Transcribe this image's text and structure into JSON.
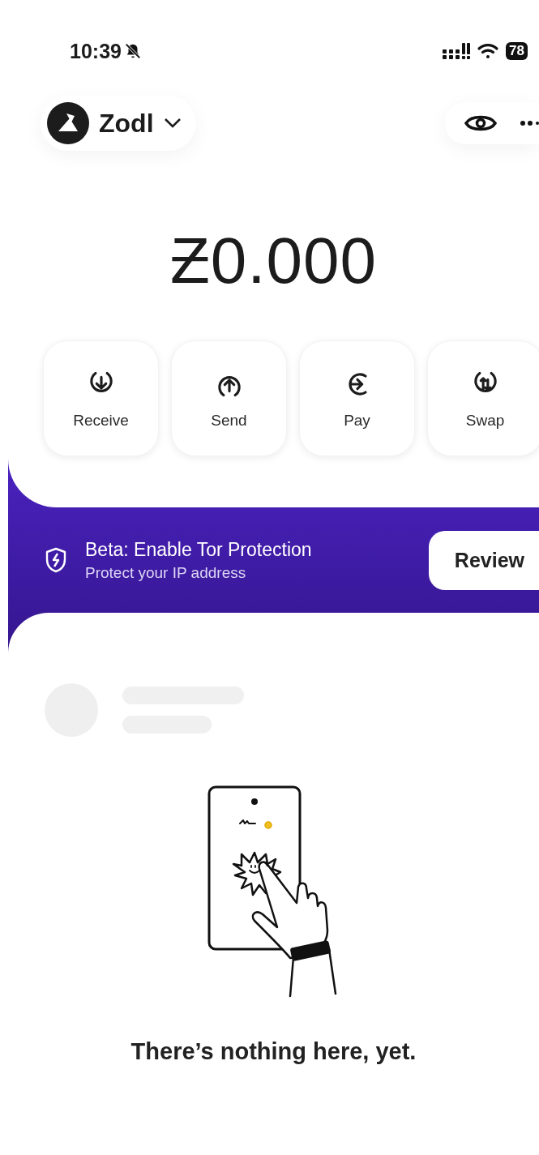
{
  "status_bar": {
    "time": "10:39",
    "battery": "78"
  },
  "header": {
    "wallet_name": "Zodl"
  },
  "balance": "Ƶ0.000",
  "actions": [
    {
      "label": "Receive",
      "kind": "receive"
    },
    {
      "label": "Send",
      "kind": "send"
    },
    {
      "label": "Pay",
      "kind": "pay"
    },
    {
      "label": "Swap",
      "kind": "swap"
    }
  ],
  "banner": {
    "title": "Beta: Enable Tor Protection",
    "subtitle": "Protect your IP address",
    "button": "Review"
  },
  "empty_state": {
    "message": "There’s nothing here, yet."
  }
}
